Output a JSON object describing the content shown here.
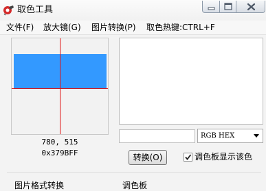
{
  "window": {
    "title": "取色工具",
    "icon": "app-color-picker-icon"
  },
  "titlebar_buttons": {
    "minimize_icon": "minimize-icon",
    "maximize_icon": "maximize-icon",
    "close_icon": "close-icon"
  },
  "menu": {
    "items": [
      {
        "label": "文件(F)"
      },
      {
        "label": "放大镜(G)"
      },
      {
        "label": "图片转换(P)"
      }
    ],
    "hotkey_text": "取色热键:CTRL+F"
  },
  "magnifier": {
    "sample_color": "#3399FF",
    "crosshair_color": "#E01010",
    "coordinates": "780, 515",
    "hex_value": "0x379BFF"
  },
  "color_input": {
    "value": ""
  },
  "format_select": {
    "selected": "RGB HEX"
  },
  "convert_button": {
    "label": "转换(O)"
  },
  "palette_checkbox": {
    "checked": true,
    "label": "调色板显示该色"
  },
  "bottom_tabs": [
    {
      "label": "图片格式转换"
    },
    {
      "label": "调色板"
    }
  ]
}
